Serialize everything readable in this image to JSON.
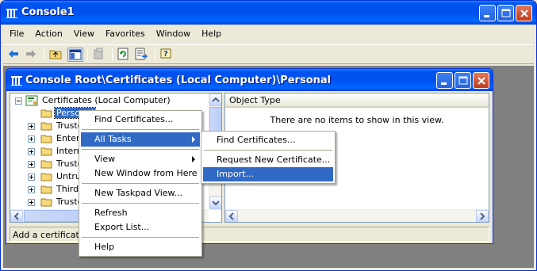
{
  "window": {
    "title": "Console1"
  },
  "menubar": [
    "File",
    "Action",
    "View",
    "Favorites",
    "Window",
    "Help"
  ],
  "toolbar": {
    "icons": [
      "back-icon",
      "forward-icon",
      "up-one-level-icon",
      "show-hide-tree-icon",
      "delete-icon",
      "refresh-icon",
      "export-list-icon",
      "help-icon"
    ]
  },
  "child_window": {
    "title": "Console Root\\Certificates (Local Computer)\\Personal"
  },
  "tree": {
    "root": "Certificates (Local Computer)",
    "items": [
      "Personal",
      "Truste",
      "Enterp",
      "Interm",
      "Truste",
      "Untrus",
      "Third-",
      "Truste"
    ]
  },
  "list": {
    "column": "Object Type",
    "empty_message": "There are no items to show in this view."
  },
  "status_text": "Add a certificate t",
  "context_menu": {
    "items": [
      "Find Certificates...",
      "All Tasks",
      "View",
      "New Window from Here",
      "New Taskpad View...",
      "Refresh",
      "Export List...",
      "Help"
    ],
    "highlighted": "All Tasks"
  },
  "submenu": {
    "items": [
      "Find Certificates...",
      "Request New Certificate...",
      "Import..."
    ],
    "highlighted": "Import..."
  },
  "colors": {
    "titlebar": "#0054E3",
    "highlight": "#316AC5",
    "face": "#ECE9D8",
    "close": "#C23A1A"
  }
}
